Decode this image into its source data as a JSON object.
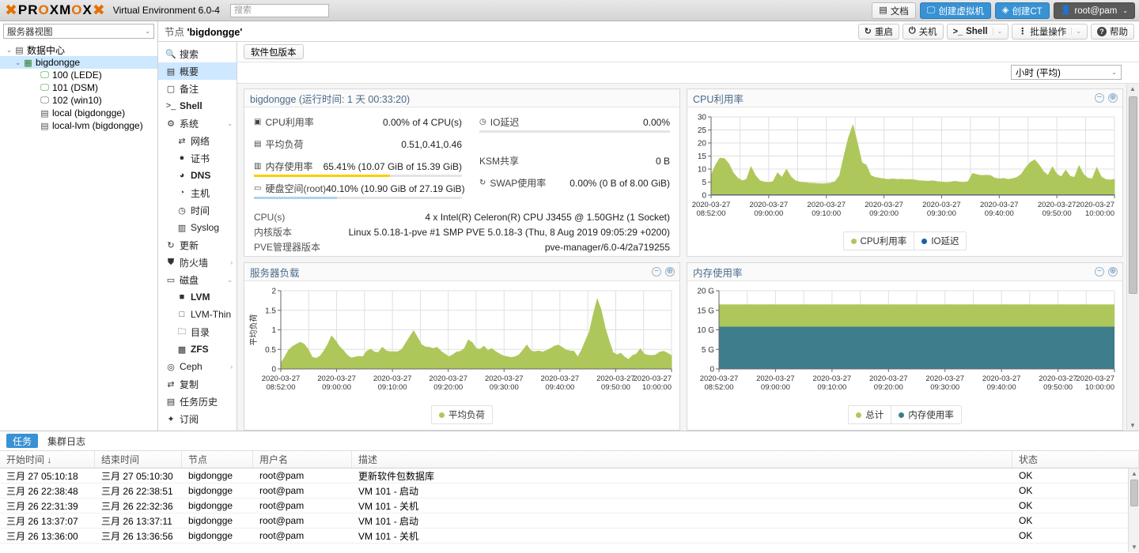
{
  "topbar": {
    "logo_text": "PROXMOX",
    "product": "Virtual Environment 6.0-4",
    "search_placeholder": "搜索",
    "buttons": [
      {
        "label": "文档",
        "icon": "book-icon",
        "style": "plain"
      },
      {
        "label": "创建虚拟机",
        "icon": "monitor-icon",
        "style": "blue"
      },
      {
        "label": "创建CT",
        "icon": "cube-icon",
        "style": "blue"
      },
      {
        "label": "root@pam",
        "icon": "user-icon",
        "style": "dark"
      }
    ]
  },
  "sidebar": {
    "view_selector": "服务器视图",
    "tree": [
      {
        "label": "数据中心",
        "level": 1,
        "icon": "datacenter-icon",
        "selected": false,
        "expander": "⌄"
      },
      {
        "label": "bigdongge",
        "level": 2,
        "icon": "node-icon",
        "selected": true,
        "expander": "⌄"
      },
      {
        "label": "100 (LEDE)",
        "level": 3,
        "icon": "vm-running-icon",
        "selected": false,
        "expander": ""
      },
      {
        "label": "101 (DSM)",
        "level": 3,
        "icon": "vm-running-icon",
        "selected": false,
        "expander": ""
      },
      {
        "label": "102 (win10)",
        "level": 3,
        "icon": "vm-stopped-icon",
        "selected": false,
        "expander": ""
      },
      {
        "label": "local (bigdongge)",
        "level": 3,
        "icon": "storage-icon",
        "selected": false,
        "expander": ""
      },
      {
        "label": "local-lvm (bigdongge)",
        "level": 3,
        "icon": "storage-icon",
        "selected": false,
        "expander": ""
      }
    ]
  },
  "breadcrumb": {
    "prefix": "节点",
    "node": "'bigdongge'"
  },
  "node_actions": [
    {
      "label": "重启",
      "icon": "restart-icon",
      "caret": false
    },
    {
      "label": "关机",
      "icon": "power-icon",
      "caret": false
    },
    {
      "label": "Shell",
      "icon": "terminal-icon",
      "caret": true
    },
    {
      "label": "批量操作",
      "icon": "kebab-icon",
      "caret": true
    },
    {
      "label": "帮助",
      "icon": "help-icon",
      "caret": false
    }
  ],
  "navmenu": [
    {
      "label": "搜索",
      "icon": "search-icon",
      "level": 0,
      "selected": false,
      "arrow": ""
    },
    {
      "label": "概要",
      "icon": "summary-icon",
      "level": 0,
      "selected": true,
      "arrow": ""
    },
    {
      "label": "备注",
      "icon": "notes-icon",
      "level": 0,
      "selected": false,
      "arrow": ""
    },
    {
      "label": "Shell",
      "icon": "terminal-icon",
      "level": 0,
      "selected": false,
      "arrow": ""
    },
    {
      "label": "系统",
      "icon": "system-icon",
      "level": 0,
      "selected": false,
      "arrow": "⌄"
    },
    {
      "label": "网络",
      "icon": "network-icon",
      "level": 1,
      "selected": false,
      "arrow": ""
    },
    {
      "label": "证书",
      "icon": "certificate-icon",
      "level": 1,
      "selected": false,
      "arrow": ""
    },
    {
      "label": "DNS",
      "icon": "dns-icon",
      "level": 1,
      "selected": false,
      "arrow": ""
    },
    {
      "label": "主机",
      "icon": "hosts-icon",
      "level": 1,
      "selected": false,
      "arrow": ""
    },
    {
      "label": "时间",
      "icon": "clock-icon",
      "level": 1,
      "selected": false,
      "arrow": ""
    },
    {
      "label": "Syslog",
      "icon": "syslog-icon",
      "level": 1,
      "selected": false,
      "arrow": ""
    },
    {
      "label": "更新",
      "icon": "update-icon",
      "level": 0,
      "selected": false,
      "arrow": ""
    },
    {
      "label": "防火墙",
      "icon": "shield-icon",
      "level": 0,
      "selected": false,
      "arrow": "›"
    },
    {
      "label": "磁盘",
      "icon": "disk-icon",
      "level": 0,
      "selected": false,
      "arrow": "⌄"
    },
    {
      "label": "LVM",
      "icon": "lvm-icon",
      "level": 1,
      "selected": false,
      "arrow": ""
    },
    {
      "label": "LVM-Thin",
      "icon": "lvmthin-icon",
      "level": 1,
      "selected": false,
      "arrow": ""
    },
    {
      "label": "目录",
      "icon": "folder-icon",
      "level": 1,
      "selected": false,
      "arrow": ""
    },
    {
      "label": "ZFS",
      "icon": "zfs-icon",
      "level": 1,
      "selected": false,
      "arrow": ""
    },
    {
      "label": "Ceph",
      "icon": "ceph-icon",
      "level": 0,
      "selected": false,
      "arrow": "›"
    },
    {
      "label": "复制",
      "icon": "replication-icon",
      "level": 0,
      "selected": false,
      "arrow": ""
    },
    {
      "label": "任务历史",
      "icon": "tasks-icon",
      "level": 0,
      "selected": false,
      "arrow": ""
    },
    {
      "label": "订阅",
      "icon": "subscription-icon",
      "level": 0,
      "selected": false,
      "arrow": ""
    }
  ],
  "toolbar": {
    "package_versions": "软件包版本",
    "range_selector": "小时 (平均)"
  },
  "status_panel": {
    "title": "bigdongge (运行时间: 1 天 00:33:20)",
    "left_metrics": [
      {
        "label": "CPU利用率",
        "icon": "cpu-icon",
        "value": "0.00% of 4 CPU(s)",
        "bar_pct": 0,
        "bar_color": "#dadada",
        "show_bar": false
      },
      {
        "label": "平均负荷",
        "icon": "load-icon",
        "value": "0.51,0.41,0.46",
        "bar_pct": 0,
        "bar_color": "#dadada",
        "show_bar": false
      },
      {
        "label": "内存使用率",
        "icon": "memory-icon",
        "value": "65.41% (10.07 GiB of 15.39 GiB)",
        "bar_pct": 65.41,
        "bar_color": "#ffcc00",
        "show_bar": true
      },
      {
        "label": "硬盘空间(root)",
        "icon": "hdd-icon",
        "value": "40.10% (10.90 GiB of 27.19 GiB)",
        "bar_pct": 40.1,
        "bar_color": "#aad4ee",
        "show_bar": true
      }
    ],
    "right_metrics": [
      {
        "label": "IO延迟",
        "icon": "iodelay-icon",
        "value": "0.00%",
        "bar_pct": 0,
        "bar_color": "#dadada",
        "show_bar": true
      },
      {
        "label": "",
        "icon": "",
        "value": "",
        "bar_pct": 0,
        "bar_color": "",
        "show_bar": false
      },
      {
        "label": "KSM共享",
        "icon": "",
        "value": "0 B",
        "bar_pct": 0,
        "bar_color": "",
        "show_bar": false
      },
      {
        "label": "SWAP使用率",
        "icon": "swap-icon",
        "value": "0.00% (0 B of 8.00 GiB)",
        "bar_pct": 0,
        "bar_color": "#dadada",
        "show_bar": false
      }
    ],
    "info": [
      {
        "key": "CPU(s)",
        "value": "4 x Intel(R) Celeron(R) CPU J3455 @ 1.50GHz (1 Socket)"
      },
      {
        "key": "内核版本",
        "value": "Linux 5.0.18-1-pve #1 SMP PVE 5.0.18-3 (Thu, 8 Aug 2019 09:05:29 +0200)"
      },
      {
        "key": "PVE管理器版本",
        "value": "pve-manager/6.0-4/2a719255"
      }
    ]
  },
  "chart_data": [
    {
      "type": "area",
      "panel_title": "CPU利用率",
      "title": "CPU利用率",
      "xlabel": "",
      "ylabel": "",
      "ylim": [
        0,
        30
      ],
      "yticks": [
        0,
        5,
        10,
        15,
        20,
        25,
        30
      ],
      "xticks": [
        "2020-03-27 08:52:00",
        "2020-03-27 09:00:00",
        "2020-03-27 09:10:00",
        "2020-03-27 09:20:00",
        "2020-03-27 09:30:00",
        "2020-03-27 09:40:00",
        "2020-03-27 09:50:00",
        "2020-03-27 10:00:00"
      ],
      "grid": true,
      "legend": [
        {
          "name": "CPU利用率",
          "color": "#aec75a"
        },
        {
          "name": "IO延迟",
          "color": "#1f5fa9"
        }
      ],
      "series": [
        {
          "name": "CPU利用率",
          "color": "#aec75a",
          "values": [
            7.5,
            11.5,
            14.2,
            14.0,
            12.0,
            8.5,
            6.5,
            5.5,
            6.0,
            10.8,
            7.5,
            5.5,
            5.0,
            4.8,
            5.2,
            8.5,
            6.8,
            9.8,
            7.0,
            5.5,
            5.0,
            4.8,
            4.6,
            4.5,
            4.4,
            4.3,
            4.4,
            4.6,
            5.2,
            7.5,
            15.0,
            22.0,
            26.8,
            20.0,
            12.5,
            11.5,
            7.5,
            6.8,
            6.5,
            6.2,
            6.0,
            6.2,
            6.0,
            6.1,
            5.9,
            6.0,
            5.8,
            5.5,
            5.4,
            5.3,
            5.5,
            5.2,
            5.0,
            4.8,
            5.0,
            5.3,
            5.0,
            4.9,
            5.2,
            8.3,
            7.8,
            7.5,
            7.6,
            7.5,
            6.5,
            6.2,
            6.4,
            6.0,
            6.3,
            6.8,
            8.0,
            10.5,
            12.5,
            13.5,
            11.5,
            9.0,
            7.5,
            10.8,
            8.0,
            7.0,
            9.5,
            7.2,
            6.8,
            11.2,
            8.0,
            6.5,
            6.2,
            10.5,
            7.0,
            6.0,
            5.8,
            6.0
          ]
        },
        {
          "name": "IO延迟",
          "color": "#1f5fa9",
          "values": [
            0.1,
            0.1,
            0.1,
            0.1,
            0.1,
            0.1,
            0.1,
            0.1,
            0.1,
            0.1,
            0.1,
            0.1,
            0.1,
            0.1,
            0.1,
            0.1,
            0.1,
            0.1,
            0.1,
            0.1,
            0.1,
            0.1,
            0.1,
            0.1,
            0.1,
            0.1,
            0.1,
            0.1,
            0.1,
            0.1,
            0.1,
            0.1,
            0.1,
            0.1,
            0.1,
            0.1,
            0.1,
            0.1,
            0.1,
            0.1,
            0.1,
            0.1,
            0.1,
            0.1,
            0.1,
            0.1,
            0.1,
            0.1,
            0.1,
            0.1,
            0.1,
            0.1,
            0.1,
            0.1,
            0.1,
            0.1,
            0.1,
            0.1,
            0.1,
            0.1,
            0.1,
            0.1,
            0.1,
            0.1,
            0.1,
            0.1,
            0.1,
            0.1,
            0.1,
            0.1,
            0.1,
            0.1,
            0.1,
            0.1,
            0.1,
            0.1,
            0.1,
            0.1,
            0.1,
            0.1,
            0.1,
            0.1,
            0.1,
            0.1,
            0.1,
            0.1,
            0.1,
            0.1,
            0.1,
            0.1,
            0.1,
            0.1
          ]
        }
      ]
    },
    {
      "type": "area",
      "panel_title": "服务器负载",
      "title": "服务器负载",
      "xlabel": "",
      "ylabel": "平均负荷",
      "ylim": [
        0,
        2
      ],
      "yticks": [
        0,
        0.5,
        1,
        1.5,
        2
      ],
      "xticks": [
        "2020-03-27 08:52:00",
        "2020-03-27 09:00:00",
        "2020-03-27 09:10:00",
        "2020-03-27 09:20:00",
        "2020-03-27 09:30:00",
        "2020-03-27 09:40:00",
        "2020-03-27 09:50:00",
        "2020-03-27 10:00:00"
      ],
      "grid": true,
      "legend": [
        {
          "name": "平均负荷",
          "color": "#aec75a"
        }
      ],
      "series": [
        {
          "name": "平均负荷",
          "color": "#aec75a",
          "values": [
            0.14,
            0.3,
            0.48,
            0.57,
            0.63,
            0.68,
            0.63,
            0.5,
            0.3,
            0.27,
            0.32,
            0.45,
            0.62,
            0.84,
            0.72,
            0.57,
            0.47,
            0.35,
            0.28,
            0.3,
            0.32,
            0.31,
            0.45,
            0.5,
            0.43,
            0.42,
            0.55,
            0.46,
            0.44,
            0.44,
            0.44,
            0.5,
            0.66,
            0.82,
            0.97,
            0.8,
            0.62,
            0.56,
            0.55,
            0.52,
            0.55,
            0.45,
            0.38,
            0.31,
            0.36,
            0.43,
            0.45,
            0.52,
            0.74,
            0.67,
            0.52,
            0.5,
            0.58,
            0.47,
            0.52,
            0.44,
            0.38,
            0.33,
            0.31,
            0.29,
            0.31,
            0.36,
            0.48,
            0.61,
            0.46,
            0.44,
            0.46,
            0.43,
            0.47,
            0.52,
            0.58,
            0.61,
            0.55,
            0.48,
            0.46,
            0.45,
            0.3,
            0.48,
            0.72,
            0.95,
            1.4,
            1.78,
            1.5,
            1.05,
            0.72,
            0.42,
            0.36,
            0.4,
            0.3,
            0.24,
            0.34,
            0.38,
            0.51,
            0.38,
            0.35,
            0.34,
            0.36,
            0.43,
            0.45,
            0.4,
            0.34
          ]
        }
      ]
    },
    {
      "type": "area",
      "panel_title": "内存使用率",
      "title": "内存使用率",
      "xlabel": "",
      "ylabel": "",
      "ylim": [
        0,
        20
      ],
      "yticks": [
        "0",
        "5 G",
        "10 G",
        "15 G",
        "20 G"
      ],
      "ytickvals": [
        0,
        5,
        10,
        15,
        20
      ],
      "xticks": [
        "2020-03-27 08:52:00",
        "2020-03-27 09:00:00",
        "2020-03-27 09:10:00",
        "2020-03-27 09:20:00",
        "2020-03-27 09:30:00",
        "2020-03-27 09:40:00",
        "2020-03-27 09:50:00",
        "2020-03-27 10:00:00"
      ],
      "grid": true,
      "legend": [
        {
          "name": "总计",
          "color": "#aec75a"
        },
        {
          "name": "内存使用率",
          "color": "#3d7d8c"
        }
      ],
      "series": [
        {
          "name": "总计",
          "color": "#aec75a",
          "constant": 16.5
        },
        {
          "name": "内存使用率",
          "color": "#3d7d8c",
          "constant": 10.8
        }
      ]
    }
  ],
  "bottom": {
    "tabs": [
      {
        "label": "任务",
        "active": true
      },
      {
        "label": "集群日志",
        "active": false
      }
    ],
    "columns": [
      "开始时间 ↓",
      "结束时间",
      "节点",
      "用户名",
      "描述",
      "状态"
    ],
    "rows": [
      {
        "start": "三月 27 05:10:18",
        "end": "三月 27 05:10:30",
        "node": "bigdongge",
        "user": "root@pam",
        "desc": "更新软件包数据库",
        "status": "OK"
      },
      {
        "start": "三月 26 22:38:48",
        "end": "三月 26 22:38:51",
        "node": "bigdongge",
        "user": "root@pam",
        "desc": "VM 101 - 启动",
        "status": "OK"
      },
      {
        "start": "三月 26 22:31:39",
        "end": "三月 26 22:32:36",
        "node": "bigdongge",
        "user": "root@pam",
        "desc": "VM 101 - 关机",
        "status": "OK"
      },
      {
        "start": "三月 26 13:37:07",
        "end": "三月 26 13:37:11",
        "node": "bigdongge",
        "user": "root@pam",
        "desc": "VM 101 - 启动",
        "status": "OK"
      },
      {
        "start": "三月 26 13:36:00",
        "end": "三月 26 13:36:56",
        "node": "bigdongge",
        "user": "root@pam",
        "desc": "VM 101 - 关机",
        "status": "OK"
      }
    ]
  },
  "colors": {
    "accent": "#3892d4",
    "brand_orange": "#e57000",
    "chart_green": "#aec75a",
    "chart_teal": "#3d7d8c",
    "chart_blue": "#1f5fa9",
    "selection": "#cde8ff",
    "mem_bar": "#ffcc00",
    "disk_bar": "#aad4ee"
  }
}
